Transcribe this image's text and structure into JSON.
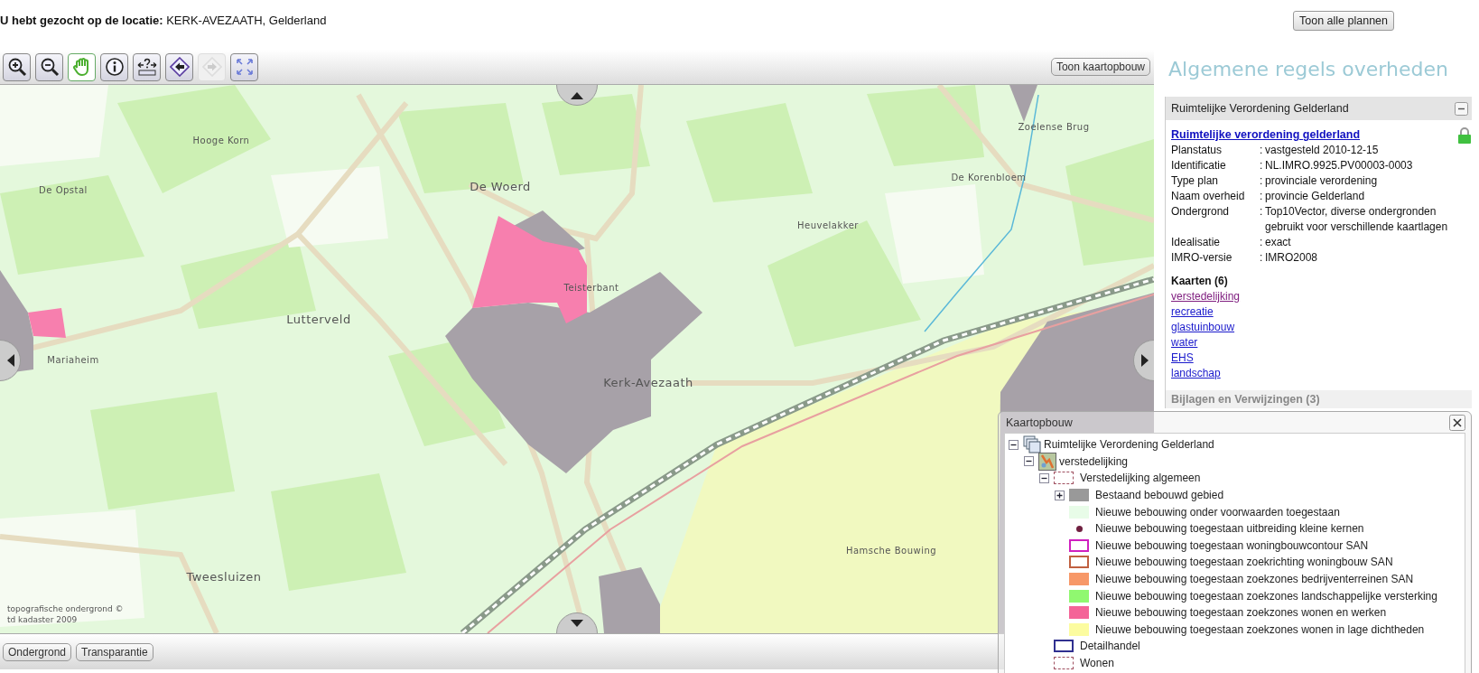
{
  "search": {
    "label": "U hebt gezocht op de locatie:",
    "value": "KERK-AVEZAATH, Gelderland"
  },
  "show_all_button": "Toon alle plannen",
  "map_toolbar": {
    "tools": [
      {
        "kind": "zoom-in",
        "selected": false,
        "disabled": false
      },
      {
        "kind": "zoom-out",
        "selected": false,
        "disabled": false
      },
      {
        "kind": "pan",
        "selected": true,
        "disabled": false
      },
      {
        "kind": "info",
        "selected": false,
        "disabled": false
      },
      {
        "kind": "measure",
        "selected": false,
        "disabled": false
      },
      {
        "kind": "back",
        "selected": false,
        "disabled": false
      },
      {
        "kind": "forward",
        "selected": false,
        "disabled": true
      },
      {
        "kind": "full-extent",
        "selected": false,
        "disabled": false
      }
    ],
    "layers_button": "Toon kaartopbouw"
  },
  "map": {
    "places": [
      "Hooge Korn",
      "De Opstal",
      "De Woerd",
      "Heuvelakker",
      "Zoelense Brug",
      "De Korenbloem",
      "Lutterveld",
      "Teisterbant",
      "Mariaheim",
      "Kerk-Avezaath",
      "Hamsche Bouwing",
      "Tweesluizen"
    ],
    "attribution": [
      "topografische ondergrond ©",
      "td kadaster 2009"
    ]
  },
  "map_bottom_bar": {
    "buttons": [
      "Ondergrond",
      "Transparantie"
    ]
  },
  "sidebar": {
    "title": "Algemene regels overheden",
    "plan_panel": {
      "title": "Ruimtelijke Verordening Gelderland",
      "link": "Ruimtelijke verordening gelderland",
      "properties": [
        {
          "label": "Planstatus",
          "separator": ":",
          "value": "vastgesteld 2010-12-15"
        },
        {
          "label": "Identificatie",
          "separator": ":",
          "value": "NL.IMRO.9925.PV00003-0003"
        },
        {
          "label": "Type plan",
          "separator": ":",
          "value": "provinciale verordening"
        },
        {
          "label": "Naam overheid",
          "separator": ":",
          "value": "provincie Gelderland"
        },
        {
          "label": "Ondergrond",
          "separator": ":",
          "value": "Top10Vector, diverse ondergronden gebruikt voor verschillende kaartlagen"
        },
        {
          "label": "Idealisatie",
          "separator": ":",
          "value": "exact"
        },
        {
          "label": "IMRO-versie",
          "separator": ":",
          "value": "IMRO2008"
        }
      ],
      "maps_heading": "Kaarten (6)",
      "maps": [
        {
          "label": "verstedelijking",
          "visited": true
        },
        {
          "label": "recreatie",
          "visited": false
        },
        {
          "label": "glastuinbouw",
          "visited": false
        },
        {
          "label": "water",
          "visited": false
        },
        {
          "label": "EHS",
          "visited": false
        },
        {
          "label": "landschap",
          "visited": false
        }
      ]
    },
    "attachments_heading": "Bijlagen en Verwijzingen (3)"
  },
  "layer_panel": {
    "title": "Kaartopbouw",
    "tree": [
      {
        "label": "Ruimtelijke Verordening Gelderland",
        "kind": "plan",
        "expanded": true,
        "children": [
          {
            "label": "verstedelijking",
            "kind": "map",
            "expanded": true,
            "children": [
              {
                "label": "Verstedelijking algemeen",
                "kind": "dashed",
                "color": "#a05060",
                "expanded": true,
                "children": [
                  {
                    "label": "Bestaand bebouwd gebied",
                    "kind": "fill",
                    "color": "#999999",
                    "expanded": false
                  },
                  {
                    "label": "Nieuwe bebouwing onder voorwaarden toegestaan",
                    "kind": "fill",
                    "color": "#e8fce8"
                  },
                  {
                    "label": "Nieuwe bebouwing toegestaan uitbreiding kleine kernen",
                    "kind": "dot",
                    "color": "#702040"
                  },
                  {
                    "label": "Nieuwe bebouwing toegestaan woningbouwcontour SAN",
                    "kind": "outline",
                    "color": "#d020c0"
                  },
                  {
                    "label": "Nieuwe bebouwing toegestaan zoekrichting woningbouw SAN",
                    "kind": "outline",
                    "color": "#c06040"
                  },
                  {
                    "label": "Nieuwe bebouwing toegestaan zoekzones bedrijventerreinen SAN",
                    "kind": "fill",
                    "color": "#f79868"
                  },
                  {
                    "label": "Nieuwe bebouwing toegestaan zoekzones landschappelijke versterking",
                    "kind": "fill",
                    "color": "#90f870"
                  },
                  {
                    "label": "Nieuwe bebouwing toegestaan zoekzones wonen en werken",
                    "kind": "fill",
                    "color": "#f46498"
                  },
                  {
                    "label": "Nieuwe bebouwing toegestaan zoekzones wonen in lage dichtheden",
                    "kind": "fill",
                    "color": "#fcfca0"
                  }
                ]
              },
              {
                "label": "Detailhandel",
                "kind": "outline",
                "color": "#303090"
              },
              {
                "label": "Wonen",
                "kind": "dashed",
                "color": "#a05060"
              }
            ]
          }
        ]
      }
    ]
  }
}
